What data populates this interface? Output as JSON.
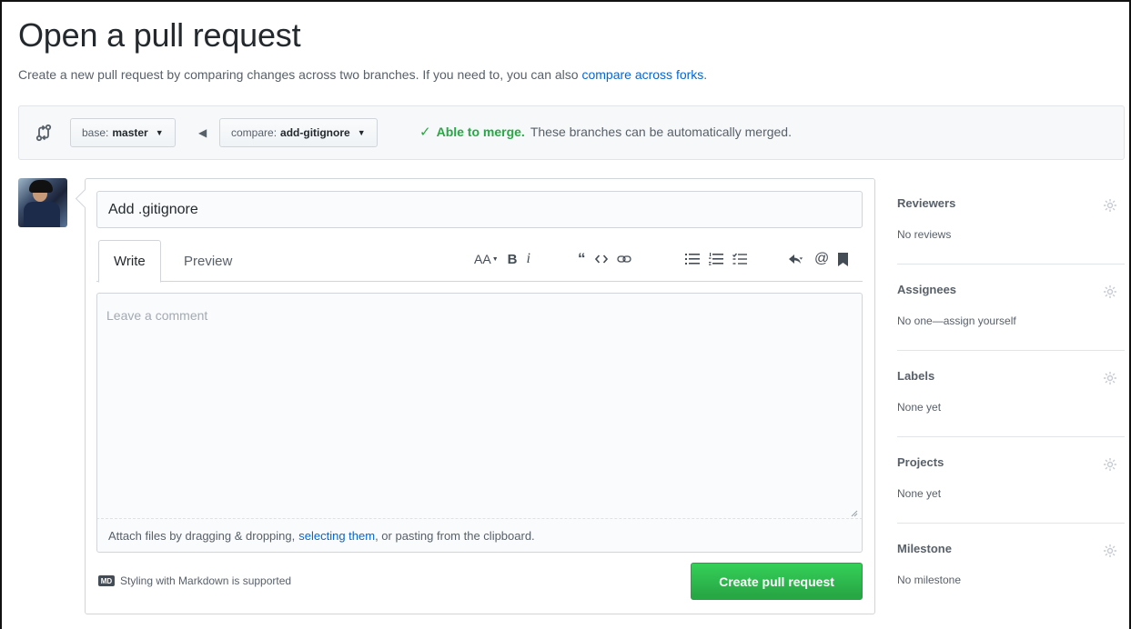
{
  "header": {
    "title": "Open a pull request",
    "subtitle": "Create a new pull request by comparing changes across two branches. If you need to, you can also ",
    "subtitle_link": "compare across forks",
    "subtitle_end": "."
  },
  "range": {
    "base_prefix": "base:",
    "base_branch": "master",
    "compare_prefix": "compare:",
    "compare_branch": "add-gitignore",
    "merge_ok": "Able to merge.",
    "merge_text": "These branches can be automatically merged."
  },
  "form": {
    "title_value": "Add .gitignore",
    "tabs": [
      "Write",
      "Preview"
    ],
    "comment_placeholder": "Leave a comment",
    "attach_prefix": "Attach files by dragging & dropping, ",
    "attach_link": "selecting them",
    "attach_suffix": ", or pasting from the clipboard.",
    "markdown_note": "Styling with Markdown is supported",
    "markdown_icon": "MD",
    "submit_label": "Create pull request"
  },
  "toolbar": {
    "header_icon": "AA",
    "bold_icon": "B",
    "italic_icon": "i",
    "mention_icon": "@"
  },
  "sidebar": {
    "sections": [
      {
        "heading": "Reviewers",
        "value": "No reviews"
      },
      {
        "heading": "Assignees",
        "value": "No one—assign yourself"
      },
      {
        "heading": "Labels",
        "value": "None yet"
      },
      {
        "heading": "Projects",
        "value": "None yet"
      },
      {
        "heading": "Milestone",
        "value": "No milestone"
      }
    ]
  },
  "colors": {
    "link": "#0366d6",
    "success": "#28a745",
    "button_green": "#2cbe4e"
  }
}
